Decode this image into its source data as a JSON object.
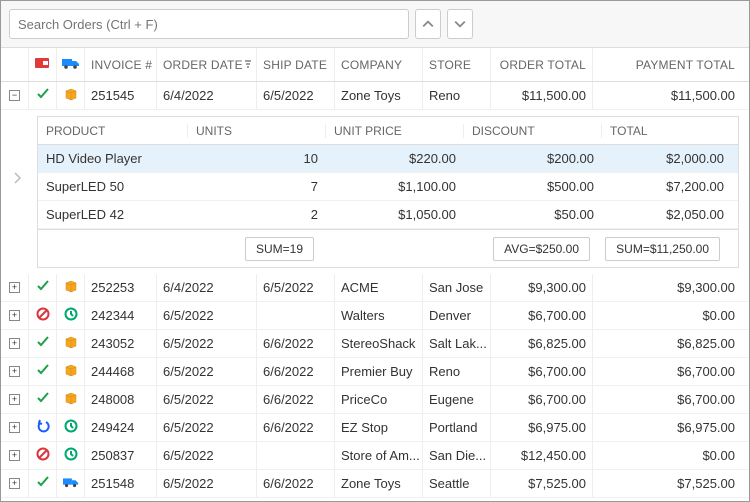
{
  "search": {
    "placeholder": "Search Orders (Ctrl + F)"
  },
  "columns": {
    "invoice": "INVOICE #",
    "orderdate": "ORDER DATE",
    "shipdate": "SHIP DATE",
    "company": "COMPANY",
    "store": "STORE",
    "ordertotal": "ORDER TOTAL",
    "paytotal": "PAYMENT TOTAL"
  },
  "expanded": {
    "invoice": "251545",
    "orderdate": "6/4/2022",
    "shipdate": "6/5/2022",
    "company": "Zone Toys",
    "store": "Reno",
    "ordertotal": "$11,500.00",
    "paytotal": "$11,500.00"
  },
  "detail": {
    "headers": {
      "product": "PRODUCT",
      "units": "UNITS",
      "unitprice": "UNIT PRICE",
      "discount": "DISCOUNT",
      "total": "TOTAL"
    },
    "rows": [
      {
        "product": "HD Video Player",
        "units": "10",
        "unitprice": "$220.00",
        "discount": "$200.00",
        "total": "$2,000.00"
      },
      {
        "product": "SuperLED 50",
        "units": "7",
        "unitprice": "$1,100.00",
        "discount": "$500.00",
        "total": "$7,200.00"
      },
      {
        "product": "SuperLED 42",
        "units": "2",
        "unitprice": "$1,050.00",
        "discount": "$50.00",
        "total": "$2,050.00"
      }
    ],
    "summary": {
      "sum_units": "SUM=19",
      "avg_discount": "AVG=$250.00",
      "sum_total": "SUM=$11,250.00"
    }
  },
  "rows": [
    {
      "status": "check",
      "ship": "box",
      "invoice": "252253",
      "orderdate": "6/4/2022",
      "shipdate": "6/5/2022",
      "company": "ACME",
      "store": "San Jose",
      "ordertotal": "$9,300.00",
      "paytotal": "$9,300.00"
    },
    {
      "status": "cancel",
      "ship": "pending",
      "invoice": "242344",
      "orderdate": "6/5/2022",
      "shipdate": "",
      "company": "Walters",
      "store": "Denver",
      "ordertotal": "$6,700.00",
      "paytotal": "$0.00"
    },
    {
      "status": "check",
      "ship": "box",
      "invoice": "243052",
      "orderdate": "6/5/2022",
      "shipdate": "6/6/2022",
      "company": "StereoShack",
      "store": "Salt Lak...",
      "ordertotal": "$6,825.00",
      "paytotal": "$6,825.00"
    },
    {
      "status": "check",
      "ship": "box",
      "invoice": "244468",
      "orderdate": "6/5/2022",
      "shipdate": "6/6/2022",
      "company": "Premier Buy",
      "store": "Reno",
      "ordertotal": "$6,700.00",
      "paytotal": "$6,700.00"
    },
    {
      "status": "check",
      "ship": "box",
      "invoice": "248008",
      "orderdate": "6/5/2022",
      "shipdate": "6/6/2022",
      "company": "PriceCo",
      "store": "Eugene",
      "ordertotal": "$6,700.00",
      "paytotal": "$6,700.00"
    },
    {
      "status": "undo",
      "ship": "pending",
      "invoice": "249424",
      "orderdate": "6/5/2022",
      "shipdate": "6/6/2022",
      "company": "EZ Stop",
      "store": "Portland",
      "ordertotal": "$6,975.00",
      "paytotal": "$6,975.00"
    },
    {
      "status": "cancel",
      "ship": "pending",
      "invoice": "250837",
      "orderdate": "6/5/2022",
      "shipdate": "",
      "company": "Store of Am...",
      "store": "San Die...",
      "ordertotal": "$12,450.00",
      "paytotal": "$0.00"
    },
    {
      "status": "check",
      "ship": "truck",
      "invoice": "251548",
      "orderdate": "6/5/2022",
      "shipdate": "6/6/2022",
      "company": "Zone Toys",
      "store": "Seattle",
      "ordertotal": "$7,525.00",
      "paytotal": "$7,525.00"
    }
  ]
}
